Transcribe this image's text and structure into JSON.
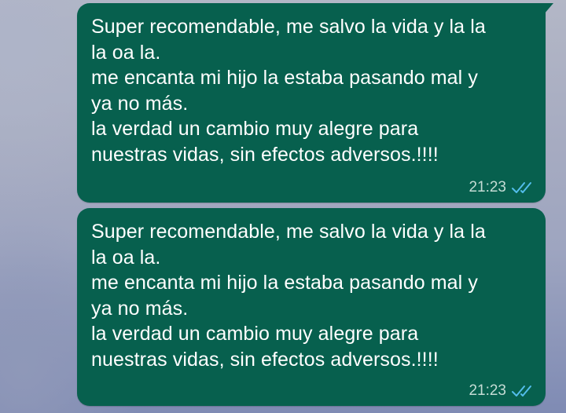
{
  "messages": [
    {
      "text": "Super recomendable, me salvo la vida y la la\nla oa la.\nme encanta mi hijo la estaba pasando mal y\nya no más.\nla verdad un cambio muy alegre para\nnuestras vidas, sin efectos adversos.!!!!",
      "time": "21:23",
      "status_icon": "double-check-read-icon"
    },
    {
      "text": "Super recomendable, me salvo la vida y la la\nla oa la.\nme encanta mi hijo la estaba pasando mal y\nya no más.\nla verdad un cambio muy alegre para\nnuestras vidas, sin efectos adversos.!!!!",
      "time": "21:23",
      "status_icon": "double-check-read-icon"
    }
  ],
  "colors": {
    "bubble": "#07604e",
    "text": "#ffffff",
    "time": "#c5dcd5",
    "read_ticks": "#53bdeb"
  }
}
